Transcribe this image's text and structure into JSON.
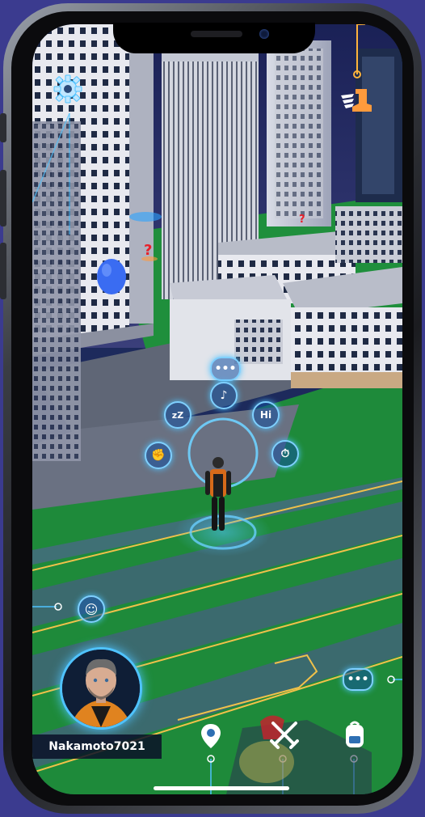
{
  "hud": {
    "settings_icon": "gear-icon",
    "quest_icon": "winged-boot-icon",
    "accent_color": "#4fc3ff",
    "quest_color": "#ff9a3c",
    "question_marker_color": "#e8202a"
  },
  "emote_wheel": {
    "items": [
      {
        "name": "chat-emote",
        "icon": "speech-bubble-icon",
        "label": ""
      },
      {
        "name": "music-emote",
        "icon": "music-note-icon",
        "label": ""
      },
      {
        "name": "sleep-emote",
        "icon": "sleep-zz-icon",
        "label": ""
      },
      {
        "name": "hi-emote",
        "icon": "hi-icon",
        "label": "Hi"
      },
      {
        "name": "flex-emote",
        "icon": "flex-arm-icon",
        "label": ""
      },
      {
        "name": "timer-emote",
        "icon": "stopwatch-icon",
        "label": ""
      }
    ]
  },
  "player": {
    "username": "Nakamoto7021",
    "emoji_icon": "smiley-icon",
    "chat_icon": "speech-bubble-icon"
  },
  "bottom_nav": {
    "items": [
      {
        "name": "map",
        "icon": "map-pin-icon"
      },
      {
        "name": "battle",
        "icon": "crossed-swords-icon"
      },
      {
        "name": "inventory",
        "icon": "backpack-icon"
      }
    ]
  }
}
